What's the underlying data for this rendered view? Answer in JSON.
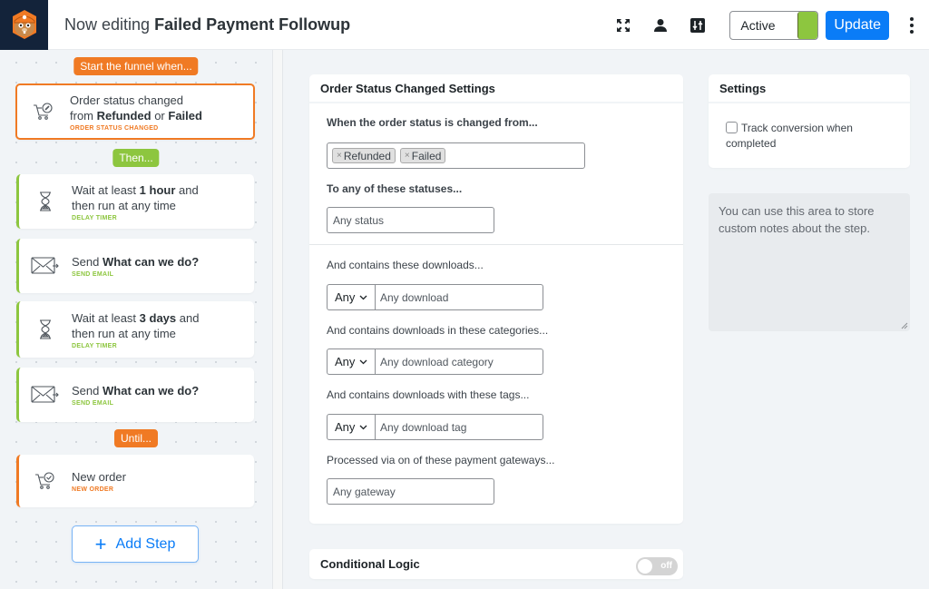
{
  "header": {
    "title_prefix": "Now editing",
    "title_name": "Failed Payment Followup",
    "status_value": "Active",
    "status_color": "#8dc63f",
    "update_label": "Update",
    "icons": [
      "expand-icon",
      "user-icon",
      "sliders-icon",
      "more-vertical-icon"
    ]
  },
  "funnel": {
    "start_badge": "Start the funnel when...",
    "then_badge": "Then...",
    "until_badge": "Until...",
    "trigger": {
      "line1": "Order status changed",
      "line2_pre": "from",
      "line2_b1": "Refunded",
      "line2_mid": "or",
      "line2_b2": "Failed",
      "type": "ORDER STATUS CHANGED",
      "icon": "cart-edit-icon"
    },
    "steps": [
      {
        "pre": "Wait at least",
        "bold": "1 hour",
        "post": "and",
        "line2": "then run at any time",
        "type": "DELAY TIMER",
        "icon": "hourglass-icon"
      },
      {
        "pre": "Send",
        "bold": "What can we do?",
        "post": "",
        "line2": "",
        "type": "SEND EMAIL",
        "icon": "email-send-icon"
      },
      {
        "pre": "Wait at least",
        "bold": "3 days",
        "post": "and",
        "line2": "then run at any time",
        "type": "DELAY TIMER",
        "icon": "hourglass-icon"
      },
      {
        "pre": "Send",
        "bold": "What can we do?",
        "post": "",
        "line2": "",
        "type": "SEND EMAIL",
        "icon": "email-send-icon"
      }
    ],
    "goal": {
      "label": "New order",
      "type": "NEW ORDER",
      "icon": "cart-check-icon"
    },
    "add_step_label": "Add Step",
    "colors": {
      "trigger": "#f07a24",
      "action": "#8dc63f",
      "link": "#0a7cf7"
    }
  },
  "settings_panel": {
    "title": "Order Status Changed Settings",
    "from_label": "When the order status is changed from...",
    "from_tags": [
      "Refunded",
      "Failed"
    ],
    "to_label": "To any of these statuses...",
    "to_placeholder": "Any status",
    "downloads_label": "And contains these downloads...",
    "downloads_mode": "Any",
    "downloads_placeholder": "Any download",
    "categories_label": "And contains downloads in these categories...",
    "categories_mode": "Any",
    "categories_placeholder": "Any download category",
    "tags_label": "And contains downloads with these tags...",
    "tags_mode": "Any",
    "tags_placeholder": "Any download tag",
    "gateways_label": "Processed via on of these payment gateways...",
    "gateways_placeholder": "Any gateway"
  },
  "conditional_logic": {
    "title": "Conditional Logic",
    "toggle_label": "off",
    "enabled": false
  },
  "side_settings": {
    "title": "Settings",
    "track_label": "Track conversion when completed",
    "track_checked": false,
    "notes_placeholder": "You can use this area to store custom notes about the step."
  }
}
